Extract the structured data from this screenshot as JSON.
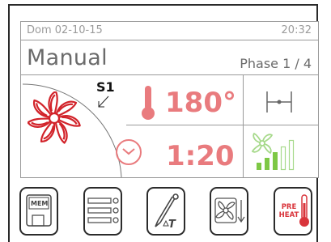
{
  "status_bar": {
    "date": "Dom 02-10-15",
    "time": "20:32"
  },
  "program": {
    "mode": "Manual",
    "phase": "Phase 1 / 4"
  },
  "fan": {
    "speed_label": "S1",
    "speed_level": 3,
    "speed_levels_total": 5
  },
  "cooking": {
    "temperature": "180°",
    "duration": "1:20"
  },
  "toolbar": {
    "mem_label": "MEM",
    "preheat_line1": "PRE",
    "preheat_line2": "HEAT"
  },
  "colors": {
    "accent_red": "#e97b7e",
    "fan_red": "#d2232a",
    "green": "#7ec845",
    "green_light": "#cfe9b6"
  }
}
